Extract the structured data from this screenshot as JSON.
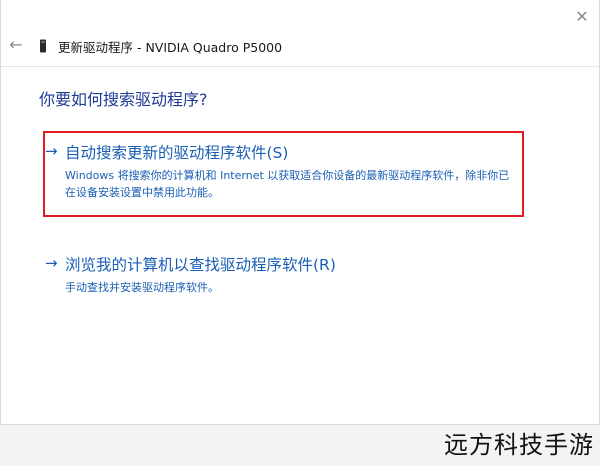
{
  "window": {
    "close_icon": "close-icon",
    "back_icon": "back-arrow-icon",
    "device_icon": "display-adapter-icon",
    "title": "更新驱动程序 - NVIDIA Quadro P5000"
  },
  "main": {
    "question": "你要如何搜索驱动程序?",
    "options": [
      {
        "arrow": "→",
        "title": "自动搜索更新的驱动程序软件(S)",
        "description": "Windows 将搜索你的计算机和 Internet 以获取适合你设备的最新驱动程序软件，除非你已在设备安装设置中禁用此功能。"
      },
      {
        "arrow": "→",
        "title": "浏览我的计算机以查找驱动程序软件(R)",
        "description": "手动查找并安装驱动程序软件。"
      }
    ]
  },
  "watermark": "远方科技手游",
  "colors": {
    "link_blue": "#1a5fb4",
    "heading_blue": "#1f3a93",
    "highlight_red": "#e01b24"
  }
}
